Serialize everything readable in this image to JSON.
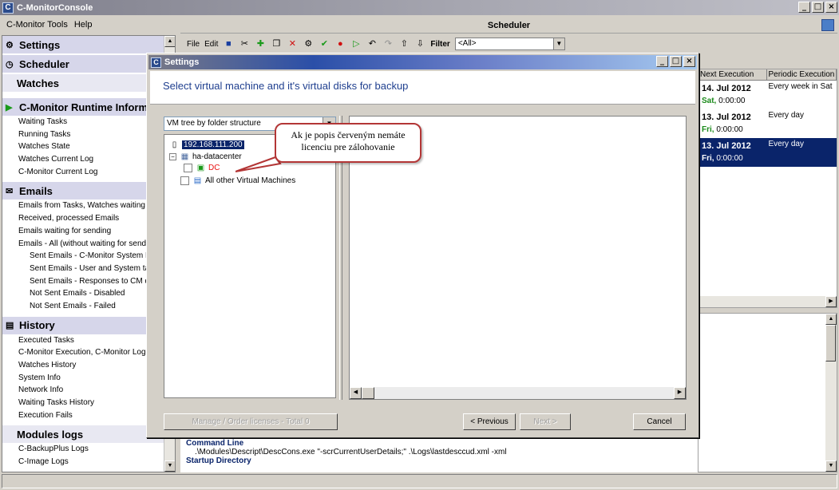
{
  "window": {
    "title": "C-MonitorConsole"
  },
  "menu": [
    "C-Monitor Tools",
    "Help"
  ],
  "left_panel": {
    "sections": [
      {
        "title": "Settings",
        "icon": "gear-icon",
        "items": []
      },
      {
        "title": "Scheduler",
        "icon": "clock-icon",
        "items": []
      },
      {
        "title": "Watches",
        "icon": "",
        "items": []
      },
      {
        "title": "C-Monitor Runtime Informat",
        "icon": "play-icon",
        "items": [
          {
            "label": "Waiting Tasks"
          },
          {
            "label": "Running Tasks"
          },
          {
            "label": "Watches State"
          },
          {
            "label": "Watches Current Log"
          },
          {
            "label": "C-Monitor Current Log"
          }
        ]
      },
      {
        "title": "Emails",
        "icon": "envelope-icon",
        "items": [
          {
            "label": "Emails from Tasks, Watches waiting for"
          },
          {
            "label": "Received, processed Emails"
          },
          {
            "label": "Emails waiting for sending"
          },
          {
            "label": "Emails - All (without waiting for sending)"
          },
          {
            "label": "Sent Emails - C-Monitor System Mes",
            "sub": true
          },
          {
            "label": "Sent Emails - User and System task",
            "sub": true
          },
          {
            "label": "Sent Emails - Responses to CM que",
            "sub": true
          },
          {
            "label": "Not Sent Emails - Disabled",
            "sub": true
          },
          {
            "label": "Not Sent Emails - Failed",
            "sub": true
          }
        ]
      },
      {
        "title": "History",
        "icon": "document-icon",
        "items": [
          {
            "label": "Executed Tasks"
          },
          {
            "label": "C-Monitor Execution, C-Monitor Log His"
          },
          {
            "label": "Watches History"
          },
          {
            "label": "System Info"
          },
          {
            "label": "Network Info"
          },
          {
            "label": "Waiting Tasks History"
          },
          {
            "label": "Execution Fails"
          }
        ]
      },
      {
        "title": "Modules logs",
        "icon": "",
        "items": [
          {
            "label": "C-BackupPlus Logs"
          },
          {
            "label": "C-Image Logs"
          }
        ]
      }
    ]
  },
  "scheduler": {
    "title": "Scheduler",
    "toolbar": {
      "file": "File",
      "edit": "Edit",
      "filter_label": "Filter",
      "filter_value": "<All>"
    },
    "columns": [
      "Next Execution",
      "Periodic Execution"
    ],
    "rows": [
      {
        "date": "14. Jul 2012",
        "day": "Sat,",
        "time": "0:00:00",
        "periodic": "Every week in Sat"
      },
      {
        "date": "13. Jul 2012",
        "day": "Fri,",
        "time": "0:00:00",
        "periodic": "Every day"
      },
      {
        "date": "13. Jul 2012",
        "day": "Fri,",
        "time": "0:00:00",
        "periodic": "Every day",
        "selected": true
      }
    ],
    "details": {
      "command_label": "Command Line",
      "command_value": ".\\Modules\\Descript\\DescCons.exe \"-scrCurrentUserDetails;\" .\\Logs\\lastdesccud.xml -xml",
      "startup_label": "Startup Directory"
    }
  },
  "dialog": {
    "title": "Settings",
    "heading": "Select virtual machine and it's virtual disks for backup",
    "view_select": "VM tree by folder structure",
    "tree": {
      "host": "192.168.111.200",
      "datacenter": "ha-datacenter",
      "vm": "DC",
      "other": "All other Virtual Machines"
    },
    "buttons": {
      "manage": "Manage / Order licenses - Total 0",
      "previous": "< Previous",
      "next": "Next >",
      "cancel": "Cancel"
    },
    "callout": {
      "line1": "Ak je popis červeným nemáte",
      "line2": "licenciu pre zálohovanie"
    }
  }
}
